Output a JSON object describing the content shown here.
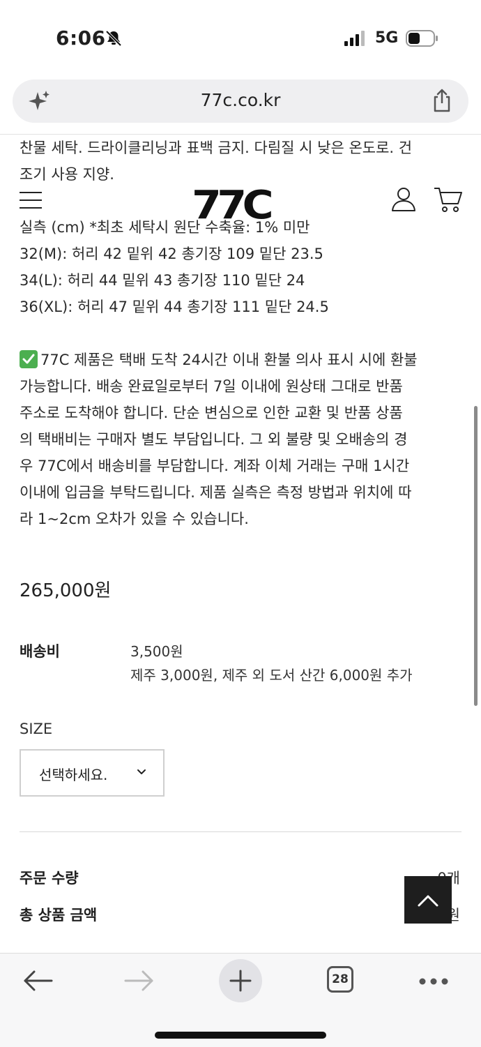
{
  "status_bar": {
    "time": "6:06",
    "network": "5G"
  },
  "browser": {
    "url": "77c.co.kr",
    "tab_count": "28"
  },
  "site": {
    "logo": "77C"
  },
  "description": {
    "lines": [
      "찬물 세탁. 드라이클리닝과 표백 금지. 다림질 시 낮은 온도로. 건",
      "조기 사용 지양.",
      "",
      "실측 (cm) *최초 세탁시 원단 수축율: 1% 미만",
      "32(M): 허리 42 밑위 42 총기장 109 밑단 23.5",
      "34(L): 허리 44 밑위 43 총기장 110 밑단 24",
      "36(XL): 허리 47 밑위 44 총기장 111 밑단 24.5"
    ],
    "policy_lines": [
      "77C 제품은 택배 도착 24시간 이내 환불 의사 표시 시에 환불",
      "가능합니다. 배송 완료일로부터 7일 이내에 원상태 그대로 반품",
      "주소로 도착해야 합니다. 단순 변심으로 인한 교환 및 반품 상품",
      "의 택배비는 구매자 별도 부담입니다. 그 외 불량 및 오배송의 경",
      "우 77C에서 배송비를 부담합니다. 계좌 이체 거래는 구매 1시간",
      "이내에 입금을 부탁드립니다. 제품 실측은 측정 방법과 위치에 따",
      "라 1~2cm 오차가 있을 수 있습니다."
    ]
  },
  "product": {
    "price": "265,000원",
    "shipping_label": "배송비",
    "shipping_fee": "3,500원",
    "shipping_extra": "제주 3,000원, 제주 외 도서 산간 6,000원 추가"
  },
  "options": {
    "size_label": "SIZE",
    "size_select": "선택하세요."
  },
  "summary": {
    "qty_label": "주문 수량",
    "qty_value": "0개",
    "total_label": "총 상품 금액",
    "total_value": "0원"
  },
  "colors": {
    "check_green": "#4caf50",
    "scroll_top_bg": "#1e1e1e"
  }
}
